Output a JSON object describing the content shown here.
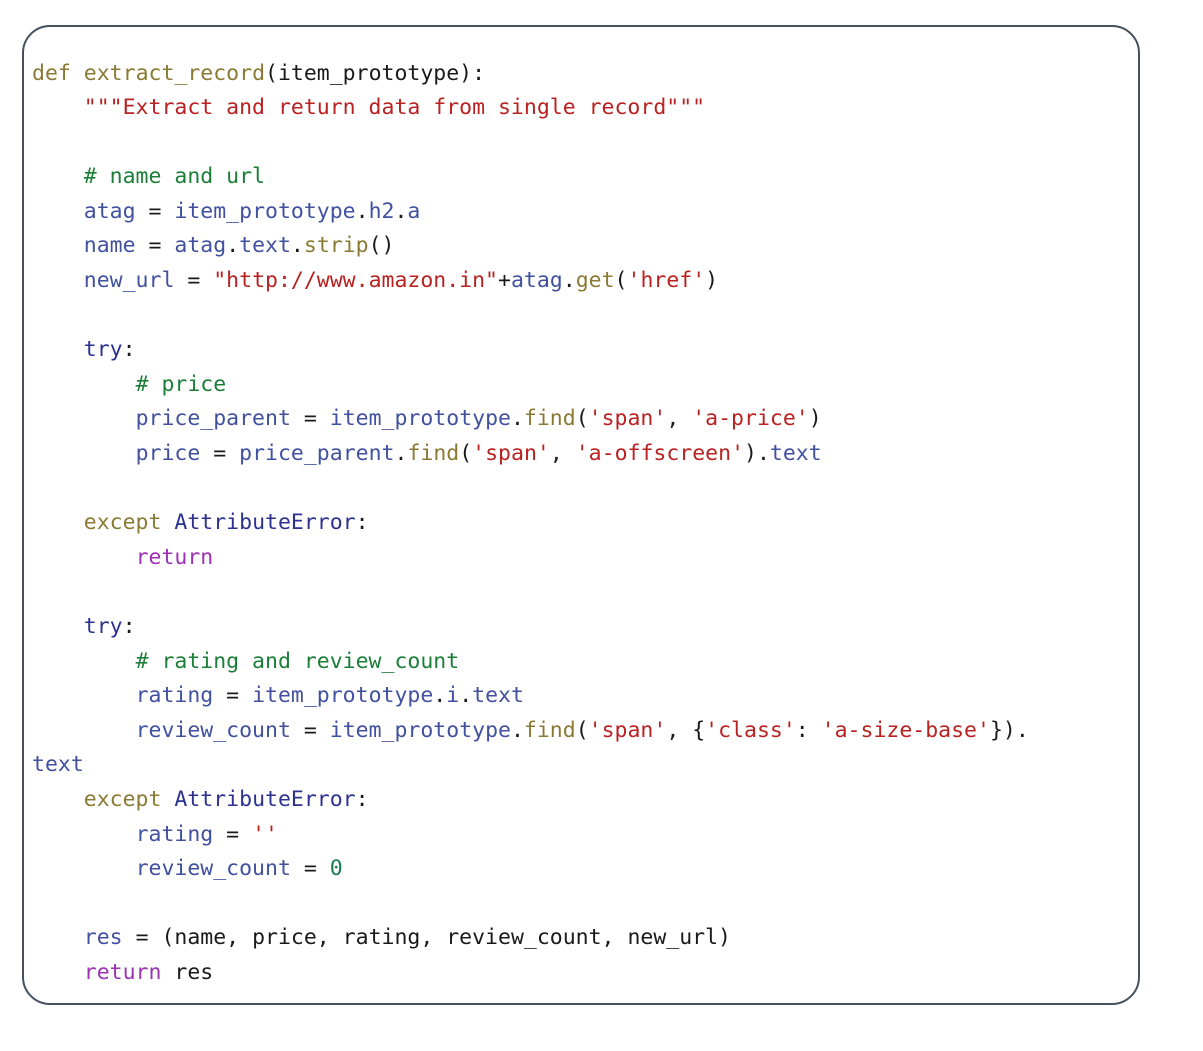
{
  "card": {
    "border_color": "#45515f",
    "background": "#ffffff",
    "corner_radius_px": 28
  },
  "theme": {
    "name": "#41519f",
    "keyword": "#8a7a34",
    "keyword_control": "#2c3291",
    "return_keyword": "#9c31b2",
    "string": "#ba2121",
    "comment": "#1b7f38",
    "number": "#177c53",
    "plain": "#1a1a1a"
  },
  "code": {
    "language": "python",
    "function_name": "extract_record",
    "plain_text": "def extract_record(item_prototype):\n    \"\"\"Extract and return data from single record\"\"\"\n\n    # name and url\n    atag = item_prototype.h2.a\n    name = atag.text.strip()\n    new_url = \"http://www.amazon.in\"+atag.get('href')\n\n    try:\n        # price\n        price_parent = item_prototype.find('span', 'a-price')\n        price = price_parent.find('span', 'a-offscreen').text\n\n    except AttributeError:\n        return\n\n    try:\n        # rating and review_count\n        rating = item_prototype.i.text\n        review_count = item_prototype.find('span', {'class': 'a-size-base'}).text\n    except AttributeError:\n        rating = ''\n        review_count = 0\n\n    res = (name, price, rating, review_count, new_url)\n    return res",
    "lines": [
      {
        "id": "line-1",
        "text": "def extract_record(item_prototype):"
      },
      {
        "id": "line-2",
        "text": "    \"\"\"Extract and return data from single record\"\"\""
      },
      {
        "id": "line-3",
        "text": ""
      },
      {
        "id": "line-4",
        "text": "    # name and url"
      },
      {
        "id": "line-5",
        "text": "    atag = item_prototype.h2.a"
      },
      {
        "id": "line-6",
        "text": "    name = atag.text.strip()"
      },
      {
        "id": "line-7",
        "text": "    new_url = \"http://www.amazon.in\"+atag.get('href')"
      },
      {
        "id": "line-8",
        "text": ""
      },
      {
        "id": "line-9",
        "text": "    try:"
      },
      {
        "id": "line-10",
        "text": "        # price"
      },
      {
        "id": "line-11",
        "text": "        price_parent = item_prototype.find('span', 'a-price')"
      },
      {
        "id": "line-12",
        "text": "        price = price_parent.find('span', 'a-offscreen').text"
      },
      {
        "id": "line-13",
        "text": ""
      },
      {
        "id": "line-14",
        "text": "    except AttributeError:"
      },
      {
        "id": "line-15",
        "text": "        return"
      },
      {
        "id": "line-16",
        "text": ""
      },
      {
        "id": "line-17",
        "text": "    try:"
      },
      {
        "id": "line-18",
        "text": "        # rating and review_count"
      },
      {
        "id": "line-19",
        "text": "        rating = item_prototype.i.text"
      },
      {
        "id": "line-20",
        "text": "        review_count = item_prototype.find('span', {'class': 'a-size-base'})."
      },
      {
        "id": "line-21",
        "text": "text"
      },
      {
        "id": "line-22",
        "text": "    except AttributeError:"
      },
      {
        "id": "line-23",
        "text": "        rating = ''"
      },
      {
        "id": "line-24",
        "text": "        review_count = 0"
      },
      {
        "id": "line-25",
        "text": ""
      },
      {
        "id": "line-26",
        "text": "    res = (name, price, rating, review_count, new_url)"
      },
      {
        "id": "line-27",
        "text": "    return res"
      }
    ],
    "tokens": {
      "line_1": [
        [
          "k",
          "def"
        ],
        [
          "p",
          " "
        ],
        [
          "k",
          "extract_record"
        ],
        [
          "p",
          "(item_prototype):"
        ]
      ],
      "line_2": [
        [
          "p",
          "    "
        ],
        [
          "s",
          "\"\"\"Extract and return data from single record\"\"\""
        ]
      ],
      "line_4": [
        [
          "p",
          "    "
        ],
        [
          "c",
          "# name and url"
        ]
      ],
      "line_5": [
        [
          "p",
          "    "
        ],
        [
          "n",
          "atag"
        ],
        [
          "p",
          " = "
        ],
        [
          "n",
          "item_prototype"
        ],
        [
          "p",
          "."
        ],
        [
          "nb",
          "h2"
        ],
        [
          "p",
          "."
        ],
        [
          "nb",
          "a"
        ]
      ],
      "line_6": [
        [
          "p",
          "    "
        ],
        [
          "n",
          "name"
        ],
        [
          "p",
          " = "
        ],
        [
          "n",
          "atag"
        ],
        [
          "p",
          "."
        ],
        [
          "nb",
          "text"
        ],
        [
          "p",
          "."
        ],
        [
          "k",
          "strip"
        ],
        [
          "p",
          "()"
        ]
      ],
      "line_7": [
        [
          "p",
          "    "
        ],
        [
          "n",
          "new_url"
        ],
        [
          "p",
          " = "
        ],
        [
          "s",
          "\"http://www.amazon.in\""
        ],
        [
          "p",
          "+"
        ],
        [
          "n",
          "atag"
        ],
        [
          "p",
          "."
        ],
        [
          "k",
          "get"
        ],
        [
          "p",
          "("
        ],
        [
          "s",
          "'href'"
        ],
        [
          "p",
          ")"
        ]
      ],
      "line_9": [
        [
          "p",
          "    "
        ],
        [
          "kw",
          "try"
        ],
        [
          "p",
          ":"
        ]
      ],
      "line_10": [
        [
          "p",
          "        "
        ],
        [
          "c",
          "# price"
        ]
      ],
      "line_11": [
        [
          "p",
          "        "
        ],
        [
          "n",
          "price_parent"
        ],
        [
          "p",
          " = "
        ],
        [
          "n",
          "item_prototype"
        ],
        [
          "p",
          "."
        ],
        [
          "k",
          "find"
        ],
        [
          "p",
          "("
        ],
        [
          "s",
          "'span'"
        ],
        [
          "p",
          ", "
        ],
        [
          "s",
          "'a-price'"
        ],
        [
          "p",
          ")"
        ]
      ],
      "line_12": [
        [
          "p",
          "        "
        ],
        [
          "n",
          "price"
        ],
        [
          "p",
          " = "
        ],
        [
          "n",
          "price_parent"
        ],
        [
          "p",
          "."
        ],
        [
          "k",
          "find"
        ],
        [
          "p",
          "("
        ],
        [
          "s",
          "'span'"
        ],
        [
          "p",
          ", "
        ],
        [
          "s",
          "'a-offscreen'"
        ],
        [
          "p",
          ")."
        ],
        [
          "nb",
          "text"
        ]
      ],
      "line_14": [
        [
          "p",
          "    "
        ],
        [
          "k",
          "except"
        ],
        [
          "p",
          " "
        ],
        [
          "kw",
          "AttributeError"
        ],
        [
          "p",
          ":"
        ]
      ],
      "line_15": [
        [
          "p",
          "        "
        ],
        [
          "ret",
          "return"
        ]
      ],
      "line_17": [
        [
          "p",
          "    "
        ],
        [
          "kw",
          "try"
        ],
        [
          "p",
          ":"
        ]
      ],
      "line_18": [
        [
          "p",
          "        "
        ],
        [
          "c",
          "# rating and review_count"
        ]
      ],
      "line_19": [
        [
          "p",
          "        "
        ],
        [
          "n",
          "rating"
        ],
        [
          "p",
          " = "
        ],
        [
          "n",
          "item_prototype"
        ],
        [
          "p",
          "."
        ],
        [
          "nb",
          "i"
        ],
        [
          "p",
          "."
        ],
        [
          "nb",
          "text"
        ]
      ],
      "line_20": [
        [
          "p",
          "        "
        ],
        [
          "n",
          "review_count"
        ],
        [
          "p",
          " = "
        ],
        [
          "n",
          "item_prototype"
        ],
        [
          "p",
          "."
        ],
        [
          "k",
          "find"
        ],
        [
          "p",
          "("
        ],
        [
          "s",
          "'span'"
        ],
        [
          "p",
          ", {"
        ],
        [
          "s",
          "'class'"
        ],
        [
          "p",
          ": "
        ],
        [
          "s",
          "'a-size-base'"
        ],
        [
          "p",
          "})."
        ]
      ],
      "line_21": [
        [
          "nb",
          "text"
        ]
      ],
      "line_22": [
        [
          "p",
          "    "
        ],
        [
          "k",
          "except"
        ],
        [
          "p",
          " "
        ],
        [
          "kw",
          "AttributeError"
        ],
        [
          "p",
          ":"
        ]
      ],
      "line_23": [
        [
          "p",
          "        "
        ],
        [
          "n",
          "rating"
        ],
        [
          "p",
          " = "
        ],
        [
          "s",
          "''"
        ]
      ],
      "line_24": [
        [
          "p",
          "        "
        ],
        [
          "n",
          "review_count"
        ],
        [
          "p",
          " = "
        ],
        [
          "num",
          "0"
        ]
      ],
      "line_26": [
        [
          "p",
          "    "
        ],
        [
          "n",
          "res"
        ],
        [
          "p",
          " = (name, price, rating, review_count, new_url)"
        ]
      ],
      "line_27": [
        [
          "p",
          "    "
        ],
        [
          "ret",
          "return"
        ],
        [
          "p",
          " res"
        ]
      ]
    }
  }
}
